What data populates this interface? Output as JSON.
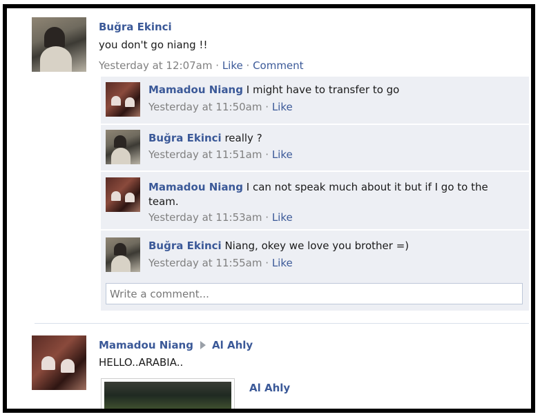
{
  "post": {
    "author": "Buğra Ekinci",
    "message": "you don't go niang !!",
    "time": "Yesterday at 12:07am",
    "sep": "·",
    "like": "Like",
    "comment": "Comment"
  },
  "comments": [
    {
      "author": "Mamadou Niang",
      "text": "I might have to transfer to go",
      "time": "Yesterday at 11:50am",
      "like": "Like"
    },
    {
      "author": "Buğra Ekinci",
      "text": "really ?",
      "time": "Yesterday at 11:51am",
      "like": "Like"
    },
    {
      "author": "Mamadou Niang",
      "text": "I can not speak much about it but if I go to the",
      "text2": "team.",
      "time": "Yesterday at 11:53am",
      "like": "Like"
    },
    {
      "author": "Buğra Ekinci",
      "text": "Niang, okey we love you brother =)",
      "time": "Yesterday at 11:55am",
      "like": "Like"
    }
  ],
  "comment_box": {
    "placeholder": "Write a comment..."
  },
  "post2": {
    "author": "Mamadou Niang",
    "target": "Al Ahly",
    "message": "HELLO..ARABIA..",
    "attachment_title": "Al Ahly"
  }
}
